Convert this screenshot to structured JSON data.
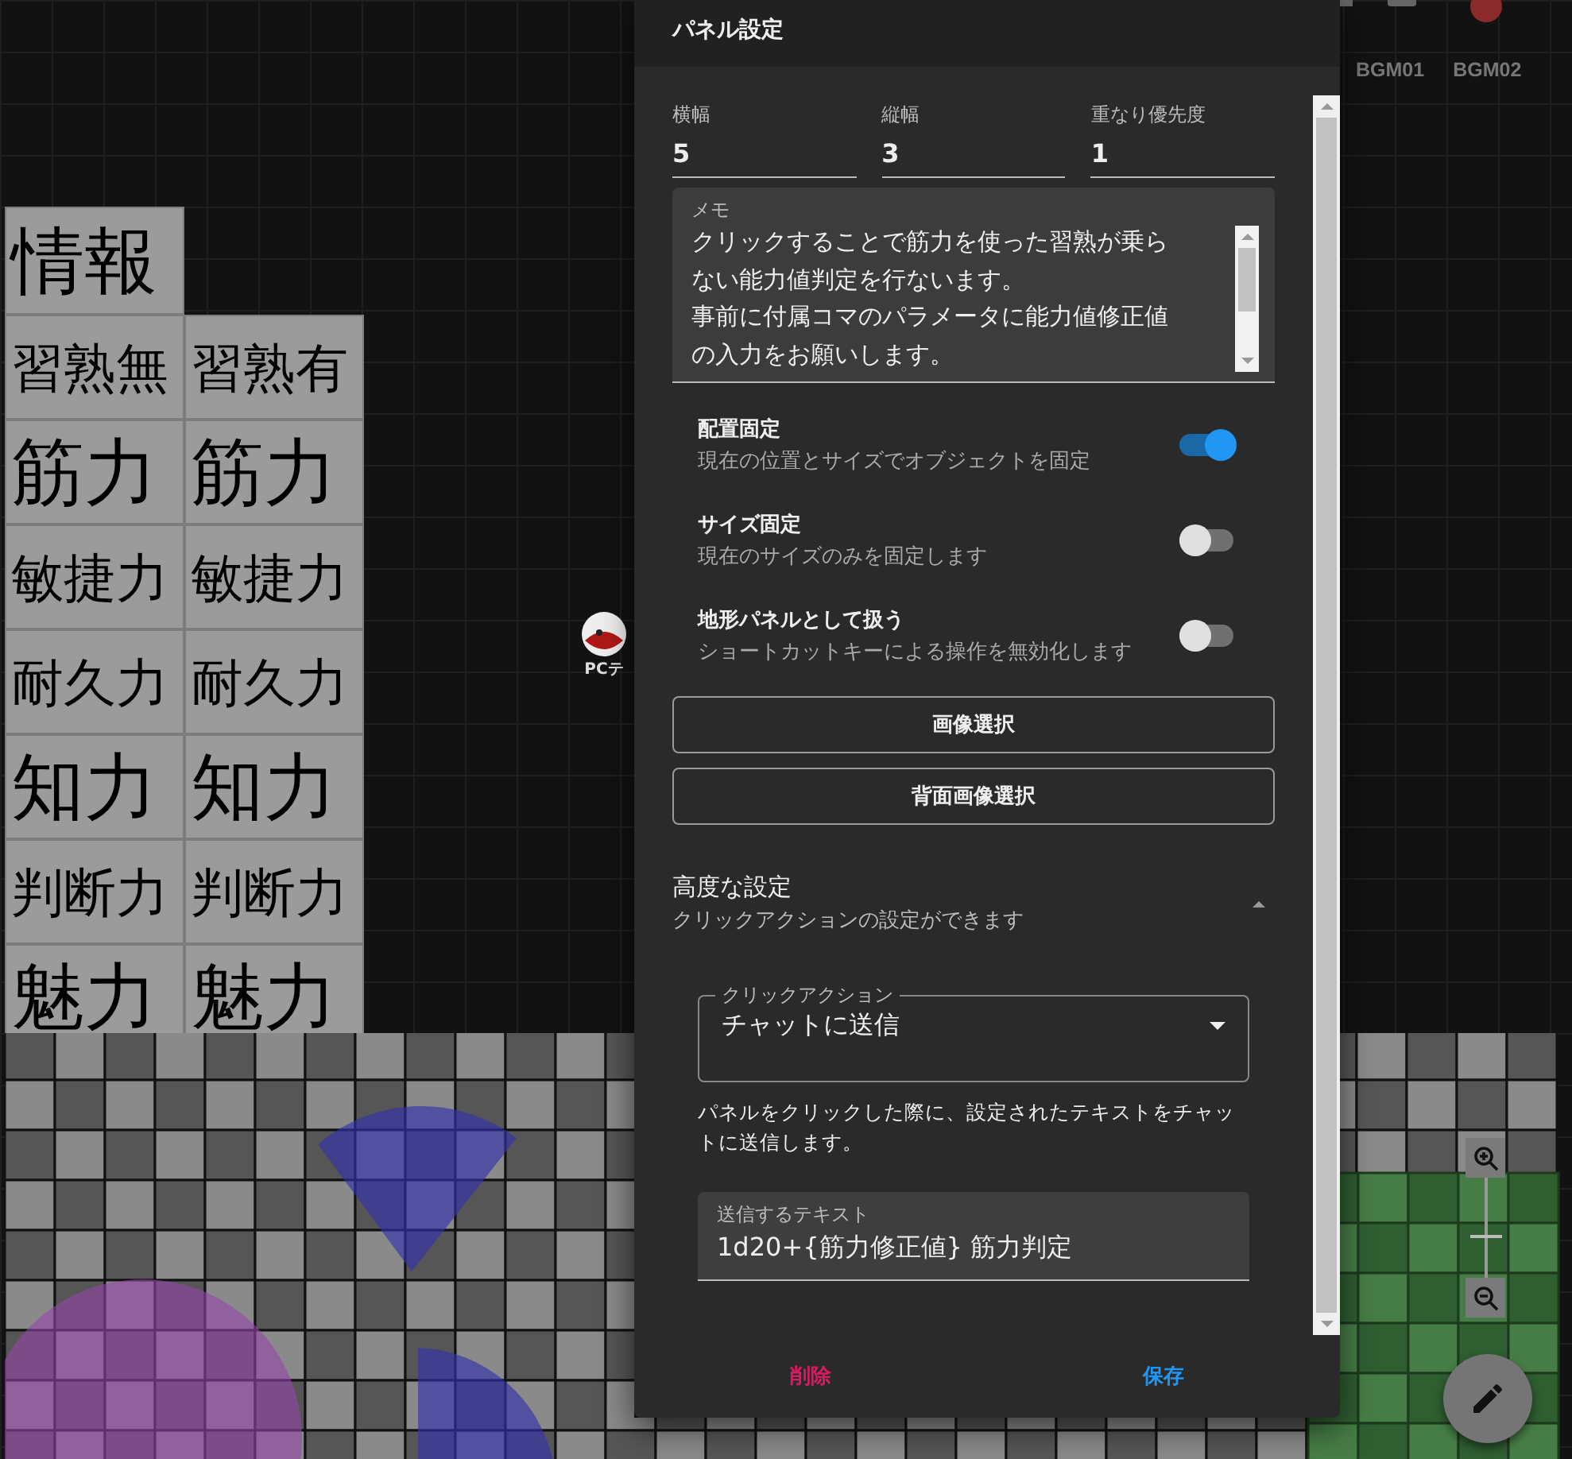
{
  "dialog": {
    "title": "パネル設定",
    "fields": [
      {
        "label": "横幅",
        "value": "5"
      },
      {
        "label": "縦幅",
        "value": "3"
      },
      {
        "label": "重なり優先度",
        "value": "1"
      }
    ],
    "memo": {
      "label": "メモ",
      "lines": [
        "クリックすることで筋力を使った習熟が乗らない能力値判定を行ないます。",
        "事前に付属コマのパラメータに能力値修正値の入力をお願いします。"
      ]
    },
    "toggles": [
      {
        "title": "配置固定",
        "subtitle": "現在の位置とサイズでオブジェクトを固定",
        "on": true
      },
      {
        "title": "サイズ固定",
        "subtitle": "現在のサイズのみを固定します",
        "on": false
      },
      {
        "title": "地形パネルとして扱う",
        "subtitle": "ショートカットキーによる操作を無効化します",
        "on": false
      }
    ],
    "buttons": [
      "画像選択",
      "背面画像選択"
    ],
    "advanced": {
      "title": "高度な設定",
      "subtitle": "クリックアクションの設定ができます",
      "expanded": true,
      "select": {
        "label": "クリックアクション",
        "value": "チャットに送信"
      },
      "help": "パネルをクリックした際に、設定されたテキストをチャットに送信します。",
      "text_field": {
        "label": "送信するテキスト",
        "value": "1d20+{筋力修正値} 筋力判定"
      }
    },
    "footer": [
      {
        "label": "削除",
        "kind": "danger"
      },
      {
        "label": "保存",
        "kind": "primary"
      }
    ]
  },
  "info_panel": {
    "header": "情報",
    "rows": [
      [
        "習熟無",
        "習熟有"
      ],
      [
        "筋力",
        "筋力"
      ],
      [
        "敏捷力",
        "敏捷力"
      ],
      [
        "耐久力",
        "耐久力"
      ],
      [
        "知力",
        "知力"
      ],
      [
        "判断力",
        "判断力"
      ],
      [
        "魅力",
        "魅力"
      ]
    ]
  },
  "bgm": [
    {
      "label": "BGM01"
    },
    {
      "label": "BGM02"
    }
  ],
  "pieces": [
    {
      "label": "PCテ"
    }
  ],
  "zoom_slider": {
    "level": 0.4
  }
}
